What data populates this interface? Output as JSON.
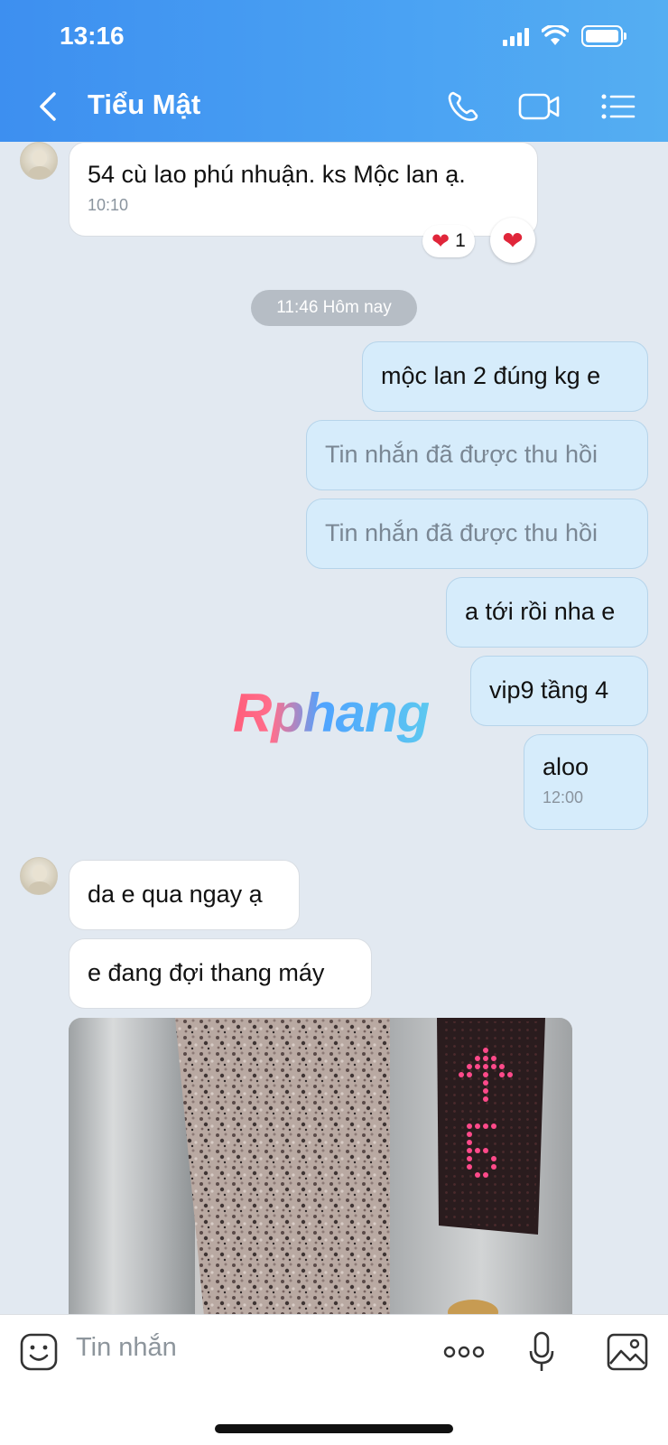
{
  "status_bar": {
    "time": "13:16"
  },
  "header": {
    "title": "Tiểu Mật"
  },
  "messages": {
    "m1": {
      "text": "54 cù lao phú nhuận. ks Mộc lan ạ.",
      "time": "10:10",
      "reaction_count": "1"
    },
    "date_chip": "11:46 Hôm nay",
    "m2": {
      "text": "mộc lan 2 đúng kg e"
    },
    "m3": {
      "text": "Tin nhắn đã được thu hồi"
    },
    "m4": {
      "text": "Tin nhắn đã được thu hồi"
    },
    "m5": {
      "text": "a tới rồi nha e"
    },
    "m6": {
      "text": "vip9 tầng 4"
    },
    "m7": {
      "text": "aloo",
      "time": "12:00"
    },
    "m8": {
      "text": "da e qua ngay ạ"
    },
    "m9": {
      "text": "e đang đợi thang máy"
    }
  },
  "watermark": "Rphang",
  "input": {
    "placeholder": "Tin nhắn"
  },
  "colors": {
    "header_start": "#3d8ff0",
    "header_end": "#55aef2",
    "out_bubble": "#d6ecfb",
    "chat_bg": "#e2e9f1"
  }
}
